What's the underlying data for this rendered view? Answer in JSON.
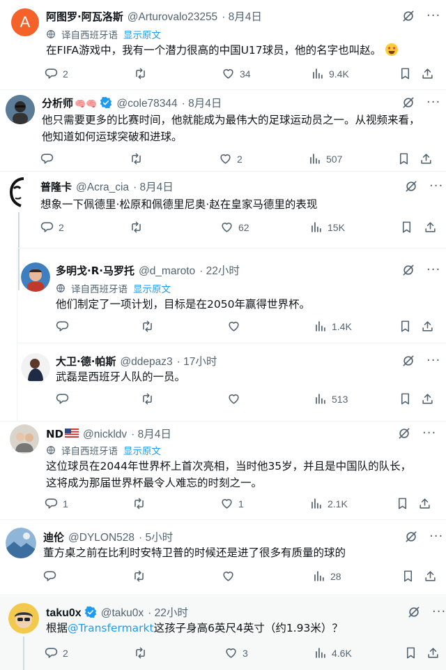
{
  "colors": {
    "link": "#1d9bf0",
    "muted": "#536471",
    "text": "#0f1419",
    "verified": "#1d9bf0"
  },
  "translate_label": "译自西班牙语",
  "show_original_label": "显示原文",
  "posts": [
    {
      "name": "阿图罗·阿瓦洛斯",
      "avatar_letter": "A",
      "handle": "@Arturovalo23255",
      "time": "· 8月4日",
      "text": "在FIFA游戏中，我有一个潜力很高的中国U17球员，他的名字也叫赵。",
      "emoji": "star-struck-emoji",
      "replies": "2",
      "retweets": "",
      "likes": "34",
      "views": "9.4K"
    },
    {
      "name": "分析师",
      "name_emoji": "🧠🧠",
      "handle": "@cole78344",
      "time": "· 8月4日",
      "text": "他只需要更多的比赛时间，他就能成为最伟大的足球运动员之一。从视频来看，他知道如何运球突破和进球。",
      "replies": "",
      "retweets": "",
      "likes": "2",
      "views": "507"
    },
    {
      "name": "普隆卡",
      "handle": "@Acra_cia",
      "time": "· 8月4日",
      "text": "想象一下佩德里·松原和佩德里尼奥·赵在皇家马德里的表现",
      "replies": "2",
      "retweets": "",
      "likes": "62",
      "views": "15K"
    },
    {
      "name": "多明戈·R·马罗托",
      "handle": "@d_maroto",
      "time": "· 22小时",
      "text": "他们制定了一项计划，目标是在2050年赢得世界杯。",
      "replies": "",
      "retweets": "",
      "likes": "",
      "views": "1.4K"
    },
    {
      "name": "大卫·德·帕斯",
      "handle": "@ddepaz3",
      "time": "· 17小时",
      "text": "武磊是西班牙人队的一员。",
      "replies": "",
      "retweets": "",
      "likes": "",
      "views": "513"
    },
    {
      "name": "ND",
      "name_flag": "us-flag",
      "handle": "@nickldv",
      "time": "· 8月4日",
      "text_lines": [
        "这位球员在2044年世界杯上首次亮相，当时他35岁，并且是中国队的队长，",
        "这将成为那届世界杯最令人难忘的时刻之一。"
      ],
      "replies": "1",
      "retweets": "",
      "likes": "1",
      "views": "2.1K"
    },
    {
      "name": "迪伦",
      "handle": "@DYLON528",
      "time": "· 5小时",
      "text": "董方桌之前在比利时安特卫普的时候还是进了很多有质量的球的",
      "replies": "",
      "retweets": "",
      "likes": "",
      "views": "28"
    },
    {
      "name": "taku0x",
      "handle": "@taku0x",
      "time": "· 22小时",
      "text_pre": "根据",
      "mention": "@Transfermarkt",
      "text_post": "这孩子身高6英尺4英寸（约1.93米）？",
      "replies": "2",
      "retweets": "",
      "likes": "3",
      "views": "4.6K"
    }
  ]
}
